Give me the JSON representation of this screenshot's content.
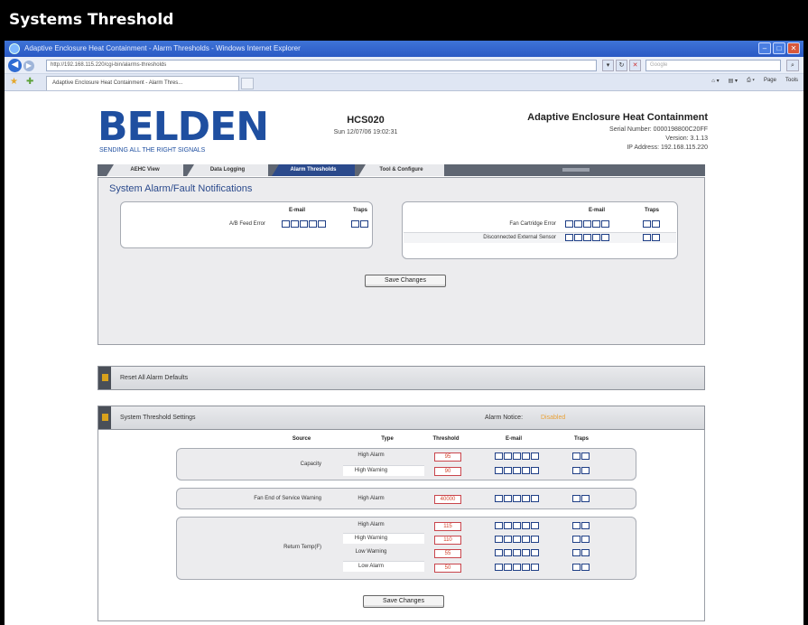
{
  "figure_title": "Systems Threshold",
  "browser": {
    "window_title": "Adaptive Enclosure Heat Containment - Alarm Thresholds - Windows Internet Explorer",
    "url": "http://192.168.115.220/cgi-bin/alarms-thresholds",
    "search_placeholder": "Google",
    "tab_title": "Adaptive Enclosure Heat Containment - Alarm Thres...",
    "tools": [
      "Page",
      "Tools"
    ]
  },
  "header": {
    "logo": "BELDEN",
    "tagline": "SENDING ALL THE RIGHT SIGNALS",
    "device_name": "HCS020",
    "device_datetime": "Sun 12/07/06 19:02:31",
    "app_title": "Adaptive Enclosure Heat Containment",
    "serial": "Serial Number: 0000198800C20FF",
    "version": "Version: 3.1.13",
    "ip": "IP Address: 192.168.115.220"
  },
  "tabs": [
    "AEHC View",
    "Data Logging",
    "Alarm Thresholds",
    "Tool & Configure"
  ],
  "alarm_notifications": {
    "title": "System Alarm/Fault Notifications",
    "email_header": "E-mail",
    "traps_header": "Traps",
    "left_rows": [
      "A/B Feed Error"
    ],
    "right_rows": [
      "Fan Cartridge Error",
      "Disconnected External Sensor"
    ],
    "save_label": "Save Changes"
  },
  "reset_section": {
    "title": "Reset All Alarm Defaults"
  },
  "threshold_settings": {
    "title": "System Threshold Settings",
    "alarm_notice_label": "Alarm Notice:",
    "alarm_notice_value": "Disabled",
    "headers": {
      "source": "Source",
      "type": "Type",
      "threshold": "Threshold",
      "email": "E-mail",
      "traps": "Traps"
    },
    "groups": [
      {
        "source": "Capacity",
        "rows": [
          {
            "type": "High Alarm",
            "value": "95"
          },
          {
            "type": "High Warning",
            "value": "90"
          }
        ]
      },
      {
        "source": "Fan End of Service Warning",
        "rows": [
          {
            "type": "High Alarm",
            "value": "40000"
          }
        ]
      },
      {
        "source": "Return Temp(F)",
        "rows": [
          {
            "type": "High Alarm",
            "value": "115"
          },
          {
            "type": "High Warning",
            "value": "110"
          },
          {
            "type": "Low Warning",
            "value": "55"
          },
          {
            "type": "Low Alarm",
            "value": "50"
          }
        ]
      }
    ],
    "save_label": "Save Changes"
  },
  "colors": {
    "brand_blue": "#1f4fa0",
    "active_tab": "#2b4a8c",
    "alarm_red": "#d2422b",
    "notice_orange": "#e8a23a"
  },
  "icons": [
    "ie-logo-icon",
    "back-arrow-icon",
    "forward-arrow-icon",
    "favorites-star-icon",
    "add-favorites-icon",
    "expand-chevron-icon"
  ]
}
